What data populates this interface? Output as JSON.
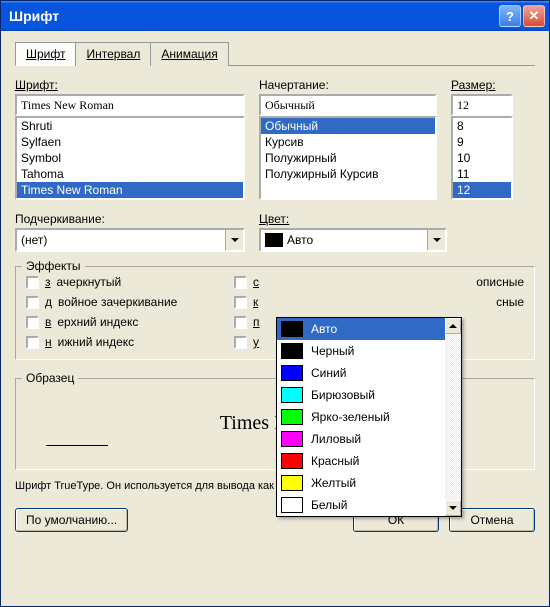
{
  "title": "Шрифт",
  "tabs": [
    "Шрифт",
    "Интервал",
    "Анимация"
  ],
  "active_tab": 0,
  "labels": {
    "font": "Шрифт:",
    "style": "Начертание:",
    "size": "Размер:",
    "underline": "Подчеркивание:",
    "color": "Цвет:",
    "effects": "Эффекты",
    "sample": "Образец"
  },
  "font": {
    "value": "Times New Roman",
    "items": [
      "Shruti",
      "Sylfaen",
      "Symbol",
      "Tahoma",
      "Times New Roman"
    ],
    "selected_index": 4
  },
  "style": {
    "value": "Обычный",
    "items": [
      "Обычный",
      "Курсив",
      "Полужирный",
      "Полужирный Курсив"
    ],
    "selected_index": 0
  },
  "size": {
    "value": "12",
    "items": [
      "8",
      "9",
      "10",
      "11",
      "12"
    ],
    "selected_index": 4
  },
  "underline": {
    "value": "(нет)"
  },
  "color": {
    "value": "Авто"
  },
  "effects": {
    "col1": [
      {
        "label": "зачеркнутый"
      },
      {
        "label": "двойное зачеркивание"
      },
      {
        "label": "верхний индекс"
      },
      {
        "label": "нижний индекс"
      }
    ],
    "col2_hint": [
      "с",
      "к",
      "п",
      "у"
    ]
  },
  "sample_text": "Times New R",
  "hint": "Шрифт TrueType. Он используется для вывода как на экран, так и на принтер.",
  "buttons": {
    "default": "По умолчанию...",
    "ok": "ОК",
    "cancel": "Отмена"
  },
  "color_dropdown": {
    "selected_index": 0,
    "items": [
      {
        "label": "Авто",
        "color": "#000000"
      },
      {
        "label": "Черный",
        "color": "#000000"
      },
      {
        "label": "Синий",
        "color": "#0000ff"
      },
      {
        "label": "Бирюзовый",
        "color": "#00ffff"
      },
      {
        "label": "Ярко-зеленый",
        "color": "#00ff00"
      },
      {
        "label": "Лиловый",
        "color": "#ff00ff"
      },
      {
        "label": "Красный",
        "color": "#ff0000"
      },
      {
        "label": "Желтый",
        "color": "#ffff00"
      },
      {
        "label": "Белый",
        "color": "#ffffff"
      }
    ]
  },
  "partial_labels": {
    "right1": "описные",
    "right2": "сные"
  }
}
